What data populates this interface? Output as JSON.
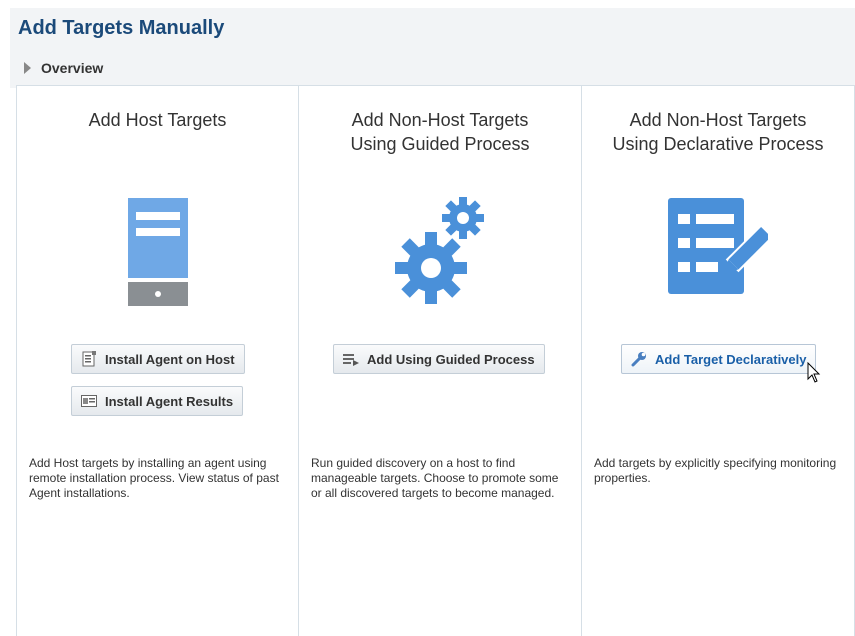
{
  "header": {
    "title": "Add Targets Manually",
    "overview_label": "Overview"
  },
  "panels": [
    {
      "title": "Add Host Targets",
      "icon": "server-icon",
      "buttons": [
        {
          "label": "Install Agent on Host",
          "icon": "install-agent-icon"
        },
        {
          "label": "Install Agent Results",
          "icon": "results-icon"
        }
      ],
      "description": "Add Host targets by installing an agent using remote installation process. View status of past Agent installations."
    },
    {
      "title": "Add Non-Host Targets\nUsing Guided Process",
      "icon": "gears-icon",
      "buttons": [
        {
          "label": "Add Using Guided Process",
          "icon": "guided-process-icon"
        }
      ],
      "description": "Run guided discovery on a host to find manageable targets. Choose to promote some or all discovered targets to become managed."
    },
    {
      "title": "Add Non-Host Targets\nUsing Declarative Process",
      "icon": "form-edit-icon",
      "buttons": [
        {
          "label": "Add Target Declaratively",
          "icon": "wrench-icon"
        }
      ],
      "description": "Add targets by explicitly specifying monitoring properties."
    }
  ],
  "colors": {
    "title": "#1b4a7a",
    "icon_blue": "#4a90d9",
    "icon_gray": "#8a8f93",
    "link_blue": "#1a5fa8"
  }
}
